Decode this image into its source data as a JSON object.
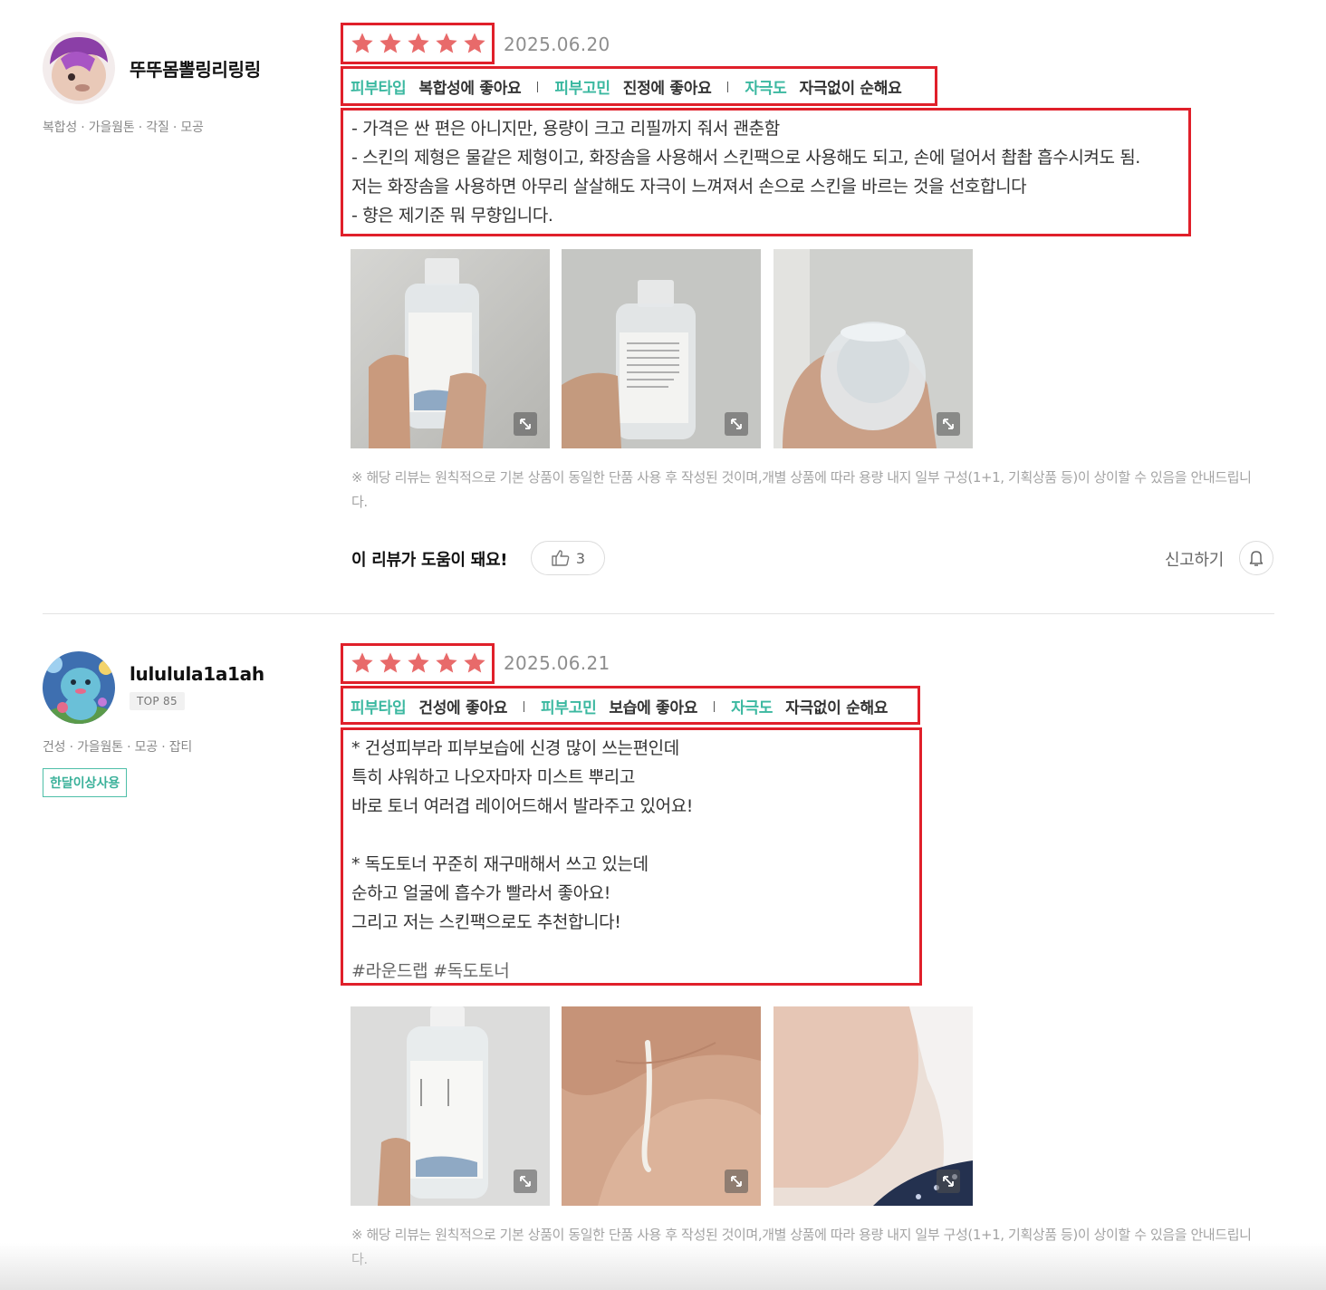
{
  "reviews": [
    {
      "username": "뚜뚜몸뽈링리링링",
      "user_tags": "복합성 · 가을웜톤 · 각질 · 모공",
      "rating": 5,
      "date": "2025.06.20",
      "attributes": [
        {
          "key": "피부타입",
          "value": "복합성에 좋아요"
        },
        {
          "key": "피부고민",
          "value": "진정에 좋아요"
        },
        {
          "key": "자극도",
          "value": "자극없이 순해요"
        }
      ],
      "text": "- 가격은 싼 편은 아니지만, 용량이 크고 리필까지 줘서 괜춘함\n- 스킨의 제형은 물같은 제형이고, 화장솜을 사용해서 스킨팩으로 사용해도 되고, 손에 덜어서 촵촵 흡수시켜도 됨.\n저는 화장솜을 사용하면 아무리 살살해도 자극이 느껴져서 손으로 스킨을 바르는 것을 선호합니다\n- 향은 제기준 뭐 무향입니다.",
      "notice": "※ 해당 리뷰는 원칙적으로 기본 상품이 동일한 단품 사용 후 작성된 것이며,개별 상품에 따라 용량 내지 일부 구성(1+1, 기획상품 등)이 상이할 수 있음을 안내드립니다.",
      "helpful_label": "이 리뷰가 도움이 돼요!",
      "helpful_count": "3",
      "report_label": "신고하기"
    },
    {
      "username": "lululula1a1ah",
      "rank": "TOP 85",
      "user_tags": "건성 · 가을웜톤 · 모공 · 잡티",
      "badge": "한달이상사용",
      "rating": 5,
      "date": "2025.06.21",
      "attributes": [
        {
          "key": "피부타입",
          "value": "건성에 좋아요"
        },
        {
          "key": "피부고민",
          "value": "보습에 좋아요"
        },
        {
          "key": "자극도",
          "value": "자극없이 순해요"
        }
      ],
      "text": "* 건성피부라 피부보습에 신경 많이 쓰는편인데\n특히 샤워하고 나오자마자 미스트 뿌리고\n바로 토너 여러겹 레이어드해서 발라주고 있어요!\n\n* 독도토너 꾸준히 재구매해서 쓰고 있는데\n순하고 얼굴에 흡수가 빨라서 좋아요!\n그리고 저는 스킨팩으로도 추천합니다!",
      "hashtags": "#라운드랩 #독도토너",
      "notice": "※ 해당 리뷰는 원칙적으로 기본 상품이 동일한 단품 사용 후 작성된 것이며,개별 상품에 따라 용량 내지 일부 구성(1+1, 기획상품 등)이 상이할 수 있음을 안내드립니다."
    }
  ],
  "colors": {
    "star": "#e86a6a",
    "attr_key": "#3bb8a0",
    "highlight_box": "#e0202a"
  },
  "icons": {
    "expand": "expand-arrows-icon",
    "thumbs_up": "thumbs-up-icon",
    "report": "bell-icon"
  }
}
